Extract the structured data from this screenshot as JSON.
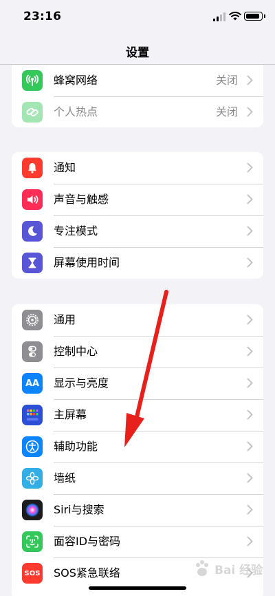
{
  "status_bar": {
    "time": "23:16"
  },
  "nav": {
    "title": "设置"
  },
  "groups": [
    {
      "rows": [
        {
          "label": "蜂窝网络",
          "value": "关闭",
          "icon": "antenna-icon",
          "color": "#34c759"
        },
        {
          "label": "个人热点",
          "value": "关闭",
          "icon": "hotspot-link-icon",
          "color": "#34c759"
        }
      ]
    },
    {
      "rows": [
        {
          "label": "通知",
          "icon": "bell-icon",
          "color": "#ff3b30"
        },
        {
          "label": "声音与触感",
          "icon": "speaker-icon",
          "color": "#ff2d55"
        },
        {
          "label": "专注模式",
          "icon": "moon-icon",
          "color": "#5856d6"
        },
        {
          "label": "屏幕使用时间",
          "icon": "hourglass-icon",
          "color": "#5856d6"
        }
      ]
    },
    {
      "rows": [
        {
          "label": "通用",
          "icon": "gear-icon",
          "color": "#8e8e93"
        },
        {
          "label": "控制中心",
          "icon": "toggles-icon",
          "color": "#8e8e93"
        },
        {
          "label": "显示与亮度",
          "icon": "text-size-icon",
          "icon_text": "AA",
          "color": "#0a84ff"
        },
        {
          "label": "主屏幕",
          "icon": "home-grid-icon",
          "color": "#2c4fd6"
        },
        {
          "label": "辅助功能",
          "icon": "accessibility-icon",
          "color": "#0a84ff"
        },
        {
          "label": "墙纸",
          "icon": "flower-icon",
          "color": "#32ade6"
        },
        {
          "label": "Siri与搜索",
          "icon": "siri-icon",
          "color": "#1c1c1e"
        },
        {
          "label": "面容ID与密码",
          "icon": "face-id-icon",
          "color": "#34c759"
        },
        {
          "label": "SOS紧急联络",
          "icon": "sos-icon",
          "icon_text": "SOS",
          "color": "#ff3b30"
        }
      ]
    }
  ],
  "overlay": {
    "arrow_color": "#e8201c"
  },
  "watermark": {
    "text": "Bai 经验"
  }
}
